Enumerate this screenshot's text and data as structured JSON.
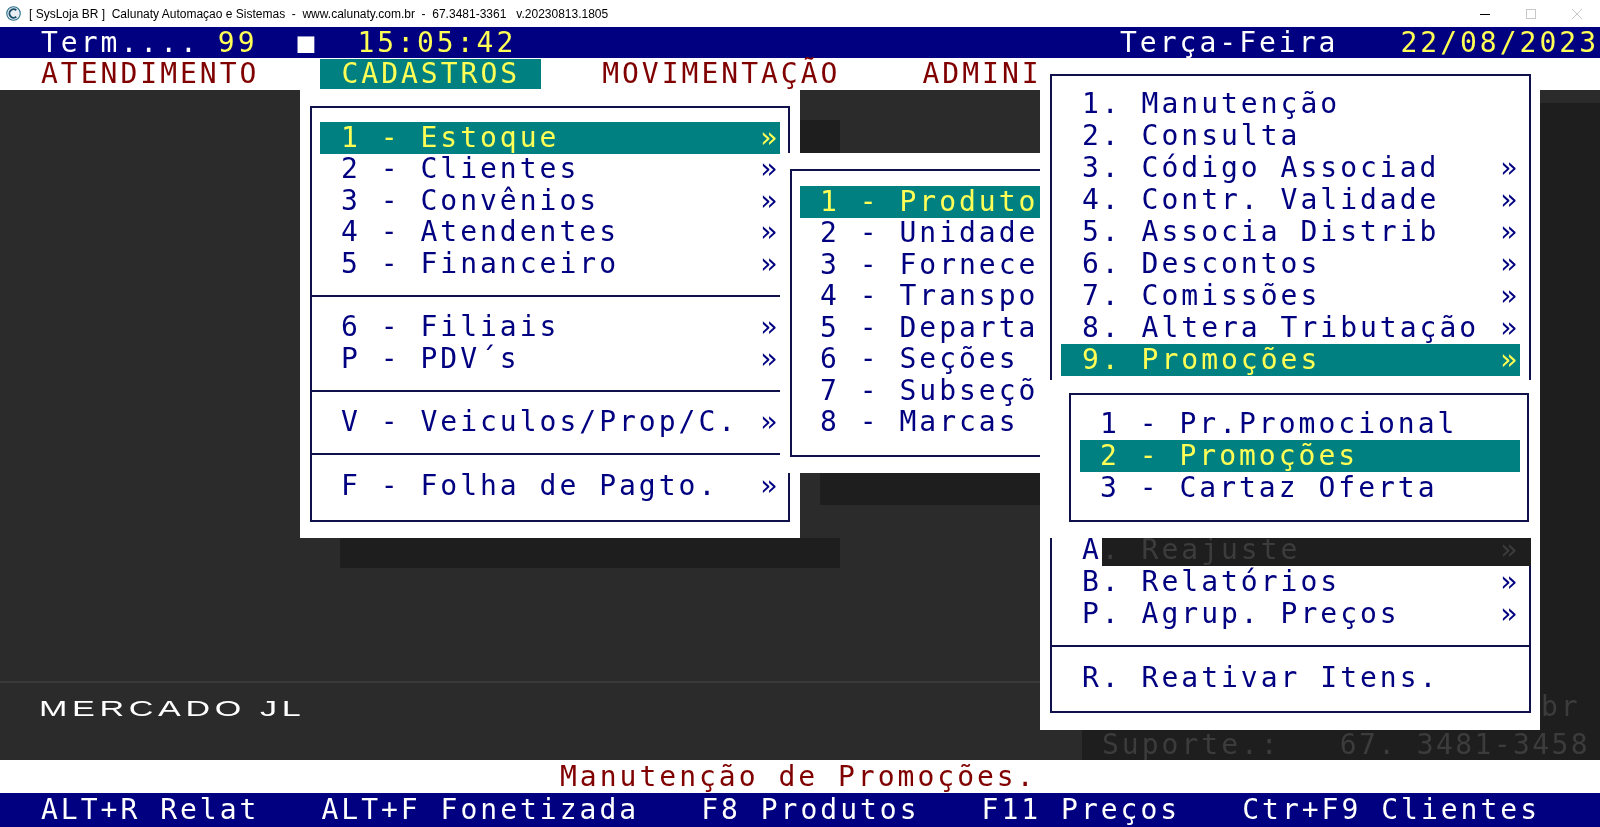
{
  "title_bar": {
    "title": "[ SysLoja BR ]  Calunaty Automaçao e Sistemas  -  www.calunaty.com.br  -  67.3481-3361   v.20230813.1805"
  },
  "status_bar": {
    "terminal_label": "Term....",
    "terminal_number": "99",
    "indicator": "■",
    "time": "15:05:42",
    "weekday": "Terça-Feira",
    "date": "22/08/2023"
  },
  "menu_bar": [
    {
      "label": "ATENDIMENTO",
      "selected": false
    },
    {
      "label": "CADASTROS",
      "selected": true
    },
    {
      "label": "MOVIMENTAÇÃO",
      "selected": false
    },
    {
      "label": "ADMINI",
      "selected": false
    }
  ],
  "cadastros_menu": {
    "groups": [
      [
        {
          "label": "1 - Estoque",
          "marker": "»",
          "selected": true
        },
        {
          "label": "2 - Clientes",
          "marker": "»",
          "selected": false
        },
        {
          "label": "3 - Convênios",
          "marker": "»",
          "selected": false
        },
        {
          "label": "4 - Atendentes",
          "marker": "»",
          "selected": false
        },
        {
          "label": "5 - Financeiro",
          "marker": "»",
          "selected": false
        }
      ],
      [
        {
          "label": "6 - Filiais",
          "marker": "»",
          "selected": false
        },
        {
          "label": "P - PDV´s",
          "marker": "»",
          "selected": false
        }
      ],
      [
        {
          "label": "V - Veiculos/Prop/C.",
          "marker": "»",
          "selected": false
        }
      ],
      [
        {
          "label": "F - Folha de Pagto.",
          "marker": "»",
          "selected": false
        }
      ]
    ]
  },
  "estoque_menu": {
    "items": [
      {
        "label": "1 - Produto",
        "selected": true
      },
      {
        "label": "2 - Unidade",
        "selected": false
      },
      {
        "label": "3 - Fornece",
        "selected": false
      },
      {
        "label": "4 - Transpo",
        "selected": false
      },
      {
        "label": "5 - Departa",
        "selected": false
      },
      {
        "label": "6 - Seções",
        "selected": false
      },
      {
        "label": "7 - Subseçõ",
        "selected": false
      },
      {
        "label": "8 - Marcas",
        "selected": false
      }
    ]
  },
  "produto_menu": {
    "groups": [
      [
        {
          "kind": "item",
          "label": "1. Manutenção",
          "selected": false
        },
        {
          "kind": "item",
          "label": "2. Consulta",
          "selected": false
        },
        {
          "kind": "item",
          "label": "3. Código Associad",
          "marker": "»",
          "selected": false
        },
        {
          "kind": "item",
          "label": "4. Contr. Validade",
          "marker": "»",
          "selected": false
        },
        {
          "kind": "item",
          "label": "5. Associa Distrib",
          "marker": "»",
          "selected": false
        },
        {
          "kind": "item",
          "label": "6. Descontos",
          "marker": "»",
          "selected": false
        },
        {
          "kind": "item",
          "label": "7. Comissões",
          "marker": "»",
          "selected": false
        },
        {
          "kind": "item",
          "label": "8. Altera Tributação",
          "marker": "»",
          "selected": false
        },
        {
          "kind": "item",
          "label": "9. Promoções",
          "marker": "»",
          "selected": true
        }
      ],
      [
        {
          "kind": "shadowed",
          "label": "A",
          "shadowed_text": ". Reajuste",
          "marker": "»",
          "selected": false
        },
        {
          "kind": "item",
          "label": "B. Relatórios",
          "marker": "»",
          "selected": false
        },
        {
          "kind": "item",
          "label": "P. Agrup. Preços",
          "marker": "»",
          "selected": false
        }
      ],
      [
        {
          "kind": "item",
          "label": "R. Reativar Itens.",
          "selected": false
        }
      ]
    ]
  },
  "promocoes_menu": {
    "items": [
      {
        "label": "1 - Pr.Promocional",
        "selected": false
      },
      {
        "label": "2 - Promoções",
        "selected": true
      },
      {
        "label": "3 - Cartaz Oferta",
        "selected": false
      }
    ]
  },
  "store_name": "MERCADO JL",
  "background_info": {
    "fragment": "br",
    "support_label": "Suporte.:",
    "support_phone": "67. 3481-3458"
  },
  "message": "Manutenção de Promoções.",
  "shortcuts": [
    "ALT+R Relat",
    "ALT+F Fonetizada",
    "F8 Produtos",
    "F11 Preços",
    "Ctr+F9 Clientes"
  ]
}
